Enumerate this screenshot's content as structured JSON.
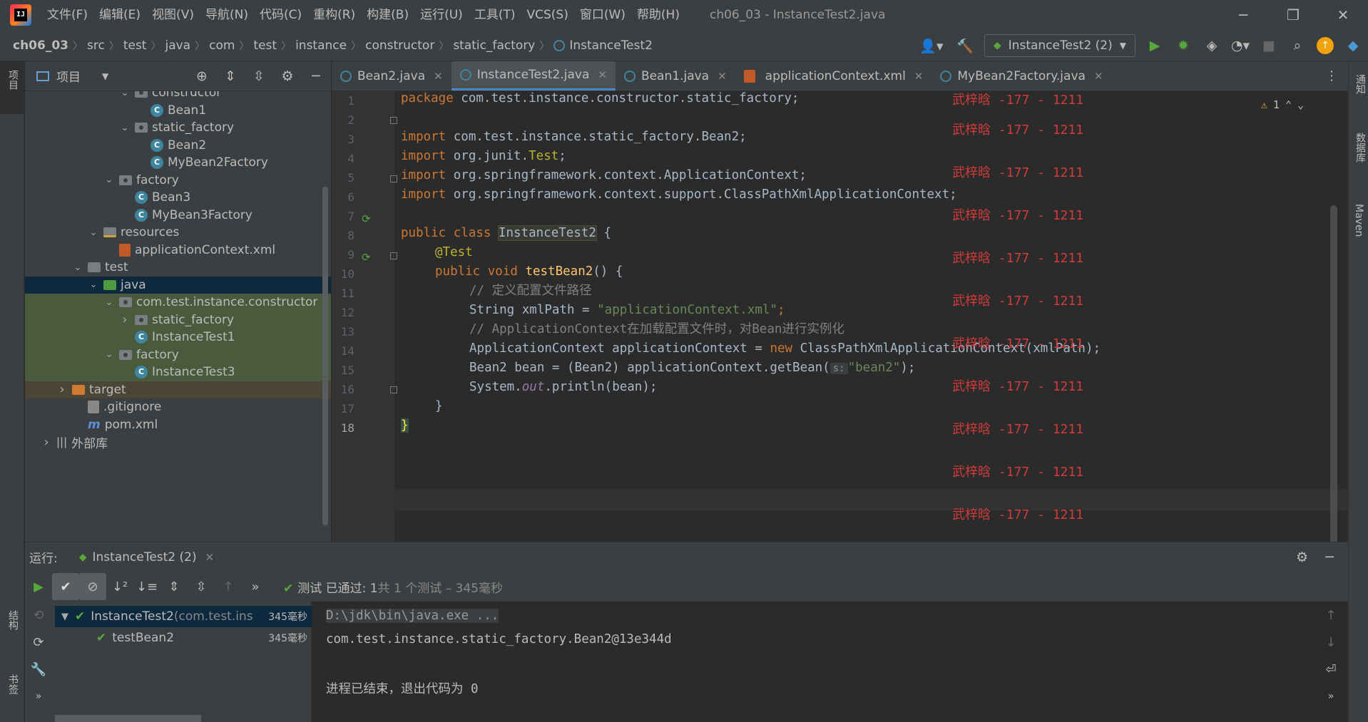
{
  "menu": [
    "文件(F)",
    "编辑(E)",
    "视图(V)",
    "导航(N)",
    "代码(C)",
    "重构(R)",
    "构建(B)",
    "运行(U)",
    "工具(T)",
    "VCS(S)",
    "窗口(W)",
    "帮助(H)"
  ],
  "window_title": "ch06_03 - InstanceTest2.java",
  "breadcrumb": [
    "ch06_03",
    "src",
    "test",
    "java",
    "com",
    "test",
    "instance",
    "constructor",
    "static_factory",
    "InstanceTest2"
  ],
  "run_config": "InstanceTest2 (2)",
  "left_stripe": {
    "project": "项目",
    "structure": "结构",
    "bookmarks": "书签"
  },
  "right_stripe": {
    "notifications": "通知",
    "database": "数据库",
    "maven": "Maven"
  },
  "project_panel": {
    "title": "项目"
  },
  "tree": [
    {
      "label": "constructor",
      "type": "pkg",
      "indent": 1,
      "arrow": "down"
    },
    {
      "label": "Bean1",
      "type": "class",
      "indent": 2,
      "arrow": "none"
    },
    {
      "label": "static_factory",
      "type": "pkg",
      "indent": 1,
      "arrow": "down"
    },
    {
      "label": "Bean2",
      "type": "class",
      "indent": 2,
      "arrow": "none"
    },
    {
      "label": "MyBean2Factory",
      "type": "class",
      "indent": 2,
      "arrow": "none"
    },
    {
      "label": "factory",
      "type": "pkg",
      "indent": 0,
      "arrow": "down"
    },
    {
      "label": "Bean3",
      "type": "class",
      "indent": 1,
      "arrow": "none"
    },
    {
      "label": "MyBean3Factory",
      "type": "class",
      "indent": 1,
      "arrow": "none"
    },
    {
      "label": "resources",
      "type": "res",
      "indent": -1,
      "arrow": "down"
    },
    {
      "label": "applicationContext.xml",
      "type": "xml",
      "indent": 0,
      "arrow": "none"
    },
    {
      "label": "test",
      "type": "folder",
      "indent": -2,
      "arrow": "down"
    },
    {
      "label": "java",
      "type": "green",
      "indent": -1,
      "arrow": "down",
      "state": "sel"
    },
    {
      "label": "com.test.instance.constructor",
      "type": "pkg",
      "indent": 0,
      "arrow": "down",
      "state": "tinted"
    },
    {
      "label": "static_factory",
      "type": "pkg",
      "indent": 1,
      "arrow": "right",
      "state": "tinted"
    },
    {
      "label": "InstanceTest1",
      "type": "class",
      "indent": 1,
      "arrow": "none",
      "state": "tinted"
    },
    {
      "label": "factory",
      "type": "pkg",
      "indent": 0,
      "arrow": "down",
      "state": "tinted"
    },
    {
      "label": "InstanceTest3",
      "type": "class",
      "indent": 1,
      "arrow": "none",
      "state": "tinted"
    },
    {
      "label": "target",
      "type": "orange",
      "indent": -3,
      "arrow": "right",
      "state": "target"
    },
    {
      "label": ".gitignore",
      "type": "git",
      "indent": -2,
      "arrow": "none"
    },
    {
      "label": "pom.xml",
      "type": "maven",
      "indent": -2,
      "arrow": "none"
    },
    {
      "label": "外部库",
      "type": "lib",
      "indent": -4,
      "arrow": "right"
    }
  ],
  "tabs": [
    {
      "label": "Bean2.java",
      "active": false
    },
    {
      "label": "InstanceTest2.java",
      "active": true
    },
    {
      "label": "Bean1.java",
      "active": false
    },
    {
      "label": "applicationContext.xml",
      "active": false
    },
    {
      "label": "MyBean2Factory.java",
      "active": false
    }
  ],
  "editor": {
    "warning_count": "1",
    "line_numbers": [
      "1",
      "2",
      "3",
      "4",
      "5",
      "6",
      "7",
      "8",
      "9",
      "10",
      "11",
      "12",
      "13",
      "14",
      "15",
      "16",
      "17",
      "18"
    ],
    "hint_label": "s:",
    "lines": {
      "l1_kw": "package",
      "l1_rest": " com.test.instance.constructor.static_factory;",
      "l3_kw": "import",
      "l3_rest": " com.test.instance.static_factory.Bean2;",
      "l4_kw": "import",
      "l4_a": " org.junit.",
      "l4_b": "Test",
      "l4_c": ";",
      "l5_kw": "import",
      "l5_rest": " org.springframework.context.ApplicationContext;",
      "l6_kw": "import",
      "l6_rest": " org.springframework.context.support.ClassPathXmlApplicationContext;",
      "l8_kw": "public class ",
      "l8_name": "InstanceTest2",
      "l8_rest": " {",
      "l9_ann": "@Test",
      "l10_kw": "public void ",
      "l10_fn": "testBean2",
      "l10_rest": "() {",
      "l11_cmt": "// 定义配置文件路径",
      "l12_a": "String xmlPath = ",
      "l12_str": "\"applicationContext.xml\"",
      "l12_c": ";",
      "l13_cmt": "// ApplicationContext在加载配置文件时，对Bean进行实例化",
      "l14_a": "ApplicationContext applicationContext = ",
      "l14_kw": "new",
      "l14_b": " ClassPathXmlApplicationContext(xmlPath);",
      "l15_a": "Bean2 bean = (Bean2) applicationContext.getBean(",
      "l15_str": "\"bean2\"",
      "l15_c": ");",
      "l16_a": "System.",
      "l16_stat": "out",
      "l16_b": ".println(bean);",
      "l17": "}",
      "l18": "}"
    },
    "watermark": "武梓晗 -177 - 1211"
  },
  "run_panel": {
    "label": "运行:",
    "tab": "InstanceTest2 (2)",
    "status_prefix": "测试 已通过: ",
    "status_count": "1",
    "status_suffix": "共 1 个测试 – 345毫秒",
    "tests": [
      {
        "name": "InstanceTest2",
        "pkg": " (com.test.ins",
        "time": "345毫秒"
      },
      {
        "name": "testBean2",
        "pkg": "",
        "time": "345毫秒"
      }
    ],
    "console": [
      "D:\\jdk\\bin\\java.exe ...",
      "com.test.instance.static_factory.Bean2@13e344d",
      "",
      "进程已结束，退出代码为 0"
    ]
  }
}
